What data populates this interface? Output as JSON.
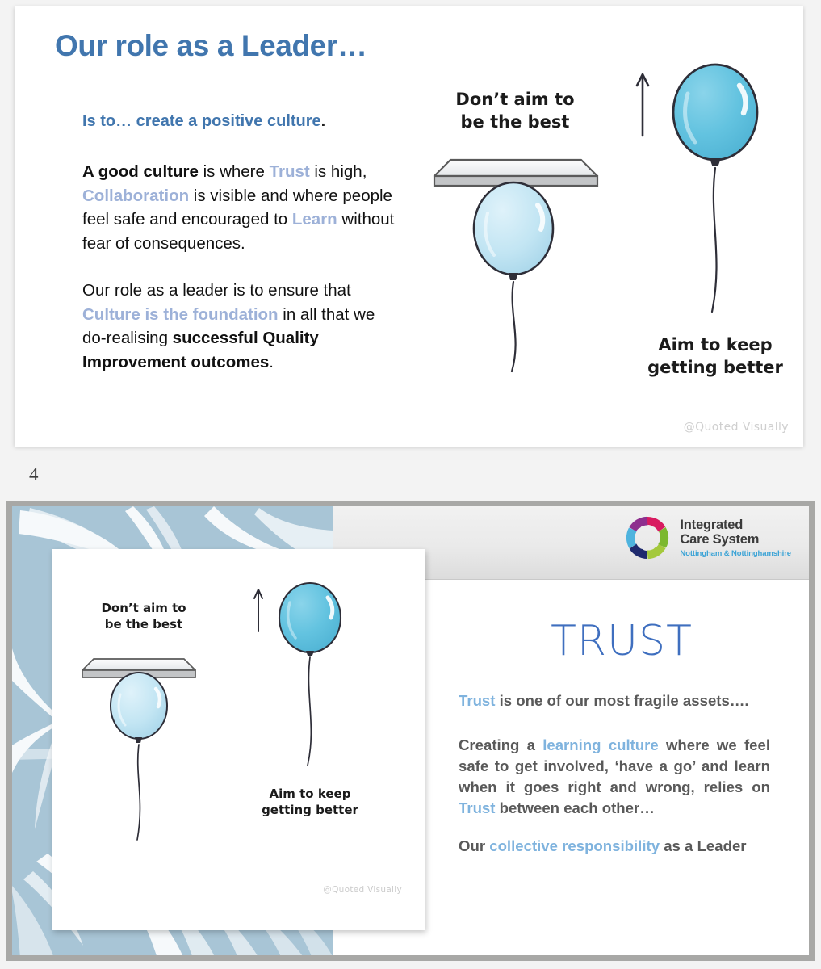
{
  "page": {
    "slide_number_label": "4",
    "background_color": "#f3f3f3"
  },
  "slide1": {
    "title": "Our role as a Leader…",
    "title_color": "#4176ae",
    "lead": {
      "prefix": "Is to…",
      "highlight": " create a positive culture",
      "suffix": "."
    },
    "paragraph1": {
      "seg1_bold": "A good culture",
      "seg2": " is where ",
      "seg3_accent": "Trust",
      "seg4": " is high, ",
      "seg5_accent": "Collaboration",
      "seg6": " is visible and where people feel safe and encouraged to ",
      "seg7_accent": "Learn",
      "seg8": " without fear of consequences."
    },
    "paragraph2": {
      "seg1": "Our role as a leader is to ensure that ",
      "seg2_accent": "Culture is the foundation",
      "seg3": " in all that we do-realising ",
      "seg4_bold": "successful Quality Improvement outcomes",
      "seg5": "."
    },
    "illustration": {
      "caption_left": "Don’t aim to\nbe the best",
      "caption_left_line1": "Don’t aim to",
      "caption_left_line2": "be the best",
      "caption_right_line1": "Aim to keep",
      "caption_right_line2": "getting better",
      "arrow_icon": "up-arrow-icon",
      "balloon_capped_color": "#bfe3f2",
      "balloon_free_color": "#63c3e0"
    },
    "watermark": "@Quoted Visually"
  },
  "slide2": {
    "logo": {
      "line1": "Integrated",
      "line2": "Care System",
      "line3": "Nottingham & Nottinghamshire",
      "ring_colors": [
        "#8e2f8e",
        "#c2185b",
        "#e2295b",
        "#7cb82f",
        "#a4c93c",
        "#1f2a6e",
        "#3f7fc1",
        "#4eb3de",
        "#9b3f9b"
      ]
    },
    "card": {
      "caption_left_line1": "Don’t aim to",
      "caption_left_line2": "be the best",
      "caption_right_line1": "Aim to keep",
      "caption_right_line2": "getting better",
      "watermark": "@Quoted Visually"
    },
    "title": "TRUST",
    "title_color": "#3f6fbf",
    "paragraph1": {
      "seg1_accent": "Trust",
      "seg2": " is one of our most fragile assets…."
    },
    "paragraph2": {
      "seg1": "Creating a ",
      "seg2_accent": "learning culture",
      "seg3": " where we feel safe to get involved, ‘have a go’ and learn when it goes right and wrong, relies on ",
      "seg4_accent": "Trust",
      "seg5": " between each other…"
    },
    "paragraph3": {
      "seg1": "Our ",
      "seg2_accent": "collective responsibility",
      "seg3": " as a Leader"
    },
    "left_panel_color": "#a8c5d6",
    "border_color": "#a8a8a6"
  }
}
